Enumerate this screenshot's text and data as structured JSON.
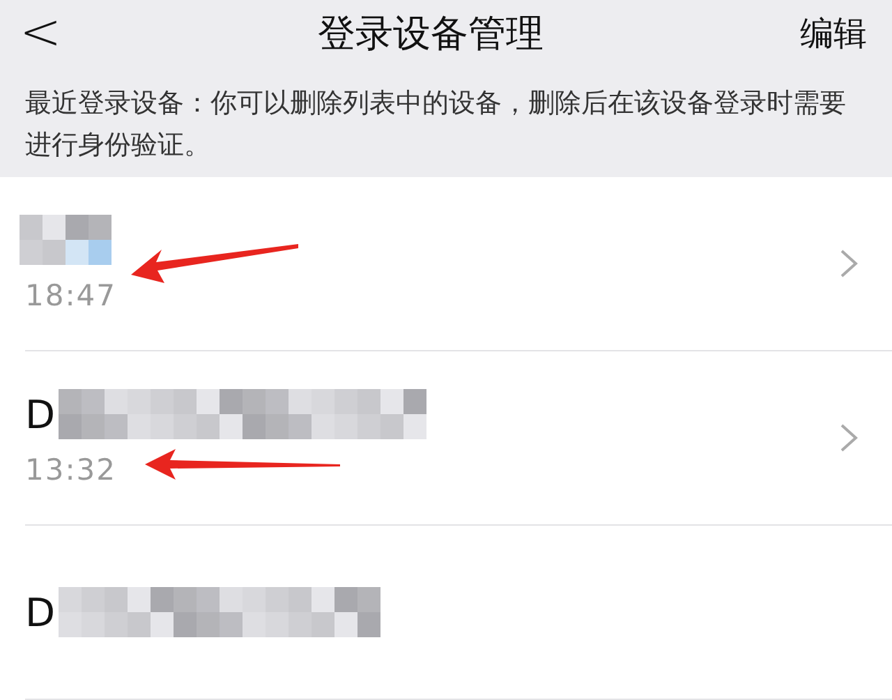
{
  "nav": {
    "back": "<",
    "title": "登录设备管理",
    "action": "编辑"
  },
  "description": "最近登录设备：你可以删除列表中的设备，删除后在该设备登录时需要进行身份验证。",
  "devices": [
    {
      "time": "18:47",
      "redacted": true,
      "annotated": true
    },
    {
      "name": "D",
      "time": "13:32",
      "redacted": true,
      "annotated": true
    },
    {
      "name": "D",
      "redacted": true,
      "annotated": false
    }
  ]
}
